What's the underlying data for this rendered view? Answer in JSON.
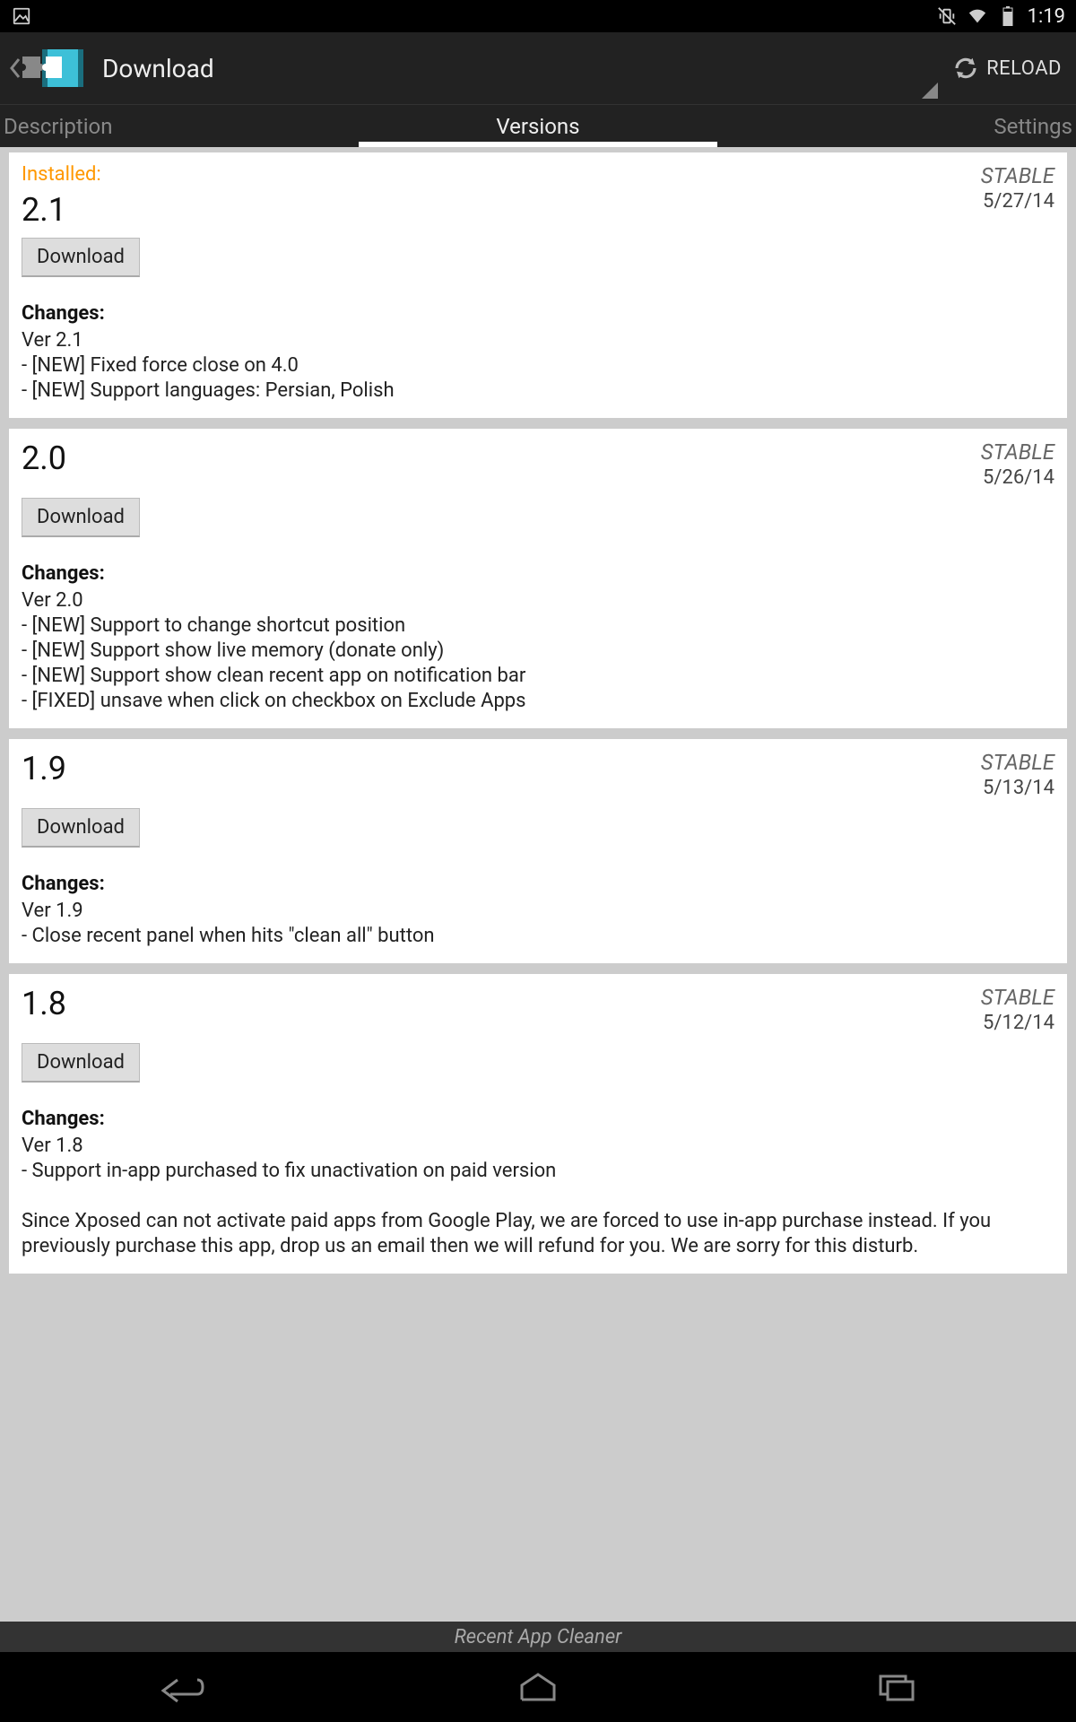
{
  "status": {
    "clock": "1:19"
  },
  "actionbar": {
    "title": "Download",
    "reload": "RELOAD"
  },
  "tabs": {
    "description": "Description",
    "versions": "Versions",
    "settings": "Settings"
  },
  "common": {
    "installed": "Installed:",
    "download_btn": "Download",
    "changes_label": "Changes:"
  },
  "versions": [
    {
      "installed": true,
      "version": "2.1",
      "stable": "STABLE",
      "date": "5/27/14",
      "changes": "Ver 2.1\n- [NEW] Fixed force close on 4.0\n- [NEW] Support languages: Persian, Polish"
    },
    {
      "installed": false,
      "version": "2.0",
      "stable": "STABLE",
      "date": "5/26/14",
      "changes": "Ver 2.0\n- [NEW] Support to change shortcut position\n- [NEW] Support show live memory (donate only)\n- [NEW] Support show clean recent app on notification bar\n- [FIXED] unsave when click on checkbox on Exclude Apps"
    },
    {
      "installed": false,
      "version": "1.9",
      "stable": "STABLE",
      "date": "5/13/14",
      "changes": "Ver 1.9\n- Close recent panel when hits \"clean all\" button"
    },
    {
      "installed": false,
      "version": "1.8",
      "stable": "STABLE",
      "date": "5/12/14",
      "changes": "Ver 1.8\n- Support in-app purchased to fix unactivation on paid version\n\nSince Xposed can not activate paid apps from Google Play, we are forced to use in-app purchase instead. If you previously purchase this app, drop us an email then we will refund for you. We are sorry for this disturb."
    }
  ],
  "module_name": "Recent App Cleaner"
}
